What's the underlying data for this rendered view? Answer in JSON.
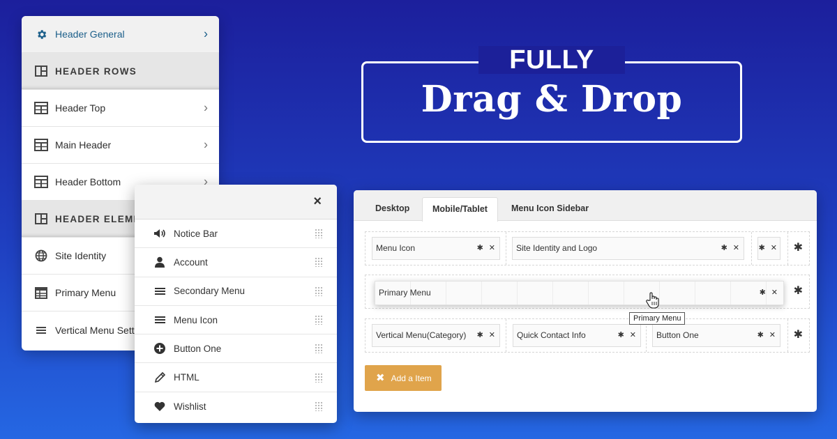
{
  "sidebar": {
    "items": [
      {
        "label": "Header General",
        "icon": "gear-icon",
        "kind": "active"
      },
      {
        "label": "HEADER ROWS",
        "icon": "columns-icon",
        "kind": "section"
      },
      {
        "label": "Header Top",
        "icon": "grid-icon",
        "kind": "item"
      },
      {
        "label": "Main Header",
        "icon": "grid-icon",
        "kind": "item"
      },
      {
        "label": "Header Bottom",
        "icon": "grid-icon",
        "kind": "item"
      },
      {
        "label": "HEADER ELEME",
        "icon": "columns-icon",
        "kind": "section"
      },
      {
        "label": "Site Identity",
        "icon": "globe-icon",
        "kind": "item"
      },
      {
        "label": "Primary Menu",
        "icon": "table-icon",
        "kind": "item"
      },
      {
        "label": "Vertical Menu Setti",
        "icon": "menu-icon",
        "kind": "item"
      }
    ]
  },
  "popup": {
    "close_label": "×",
    "items": [
      {
        "label": "Notice Bar",
        "icon": "megaphone-icon"
      },
      {
        "label": "Account",
        "icon": "user-icon"
      },
      {
        "label": "Secondary Menu",
        "icon": "menu-icon"
      },
      {
        "label": "Menu Icon",
        "icon": "menu-icon"
      },
      {
        "label": "Button One",
        "icon": "plus-circle-icon"
      },
      {
        "label": "HTML",
        "icon": "pencil-icon"
      },
      {
        "label": "Wishlist",
        "icon": "heart-icon"
      }
    ]
  },
  "headline": {
    "top": "FULLY",
    "main": "Drag & Drop"
  },
  "builder": {
    "tabs": [
      "Desktop",
      "Mobile/Tablet",
      "Menu Icon Sidebar"
    ],
    "active_tab": "Mobile/Tablet",
    "row1": [
      "Menu Icon",
      "Site Identity and Logo"
    ],
    "dragging_item": "Primary Menu",
    "tooltip": "Primary Menu",
    "row3": [
      "Vertical Menu(Category)",
      "Quick Contact Info",
      "Button One"
    ],
    "add_button": "Add a Item",
    "add_icon": "✖"
  },
  "colors": {
    "background_top": "#1c1f9c",
    "background_bottom": "#2567e3",
    "accent_active": "#1c5f8a",
    "add_button": "#e0a44b"
  }
}
